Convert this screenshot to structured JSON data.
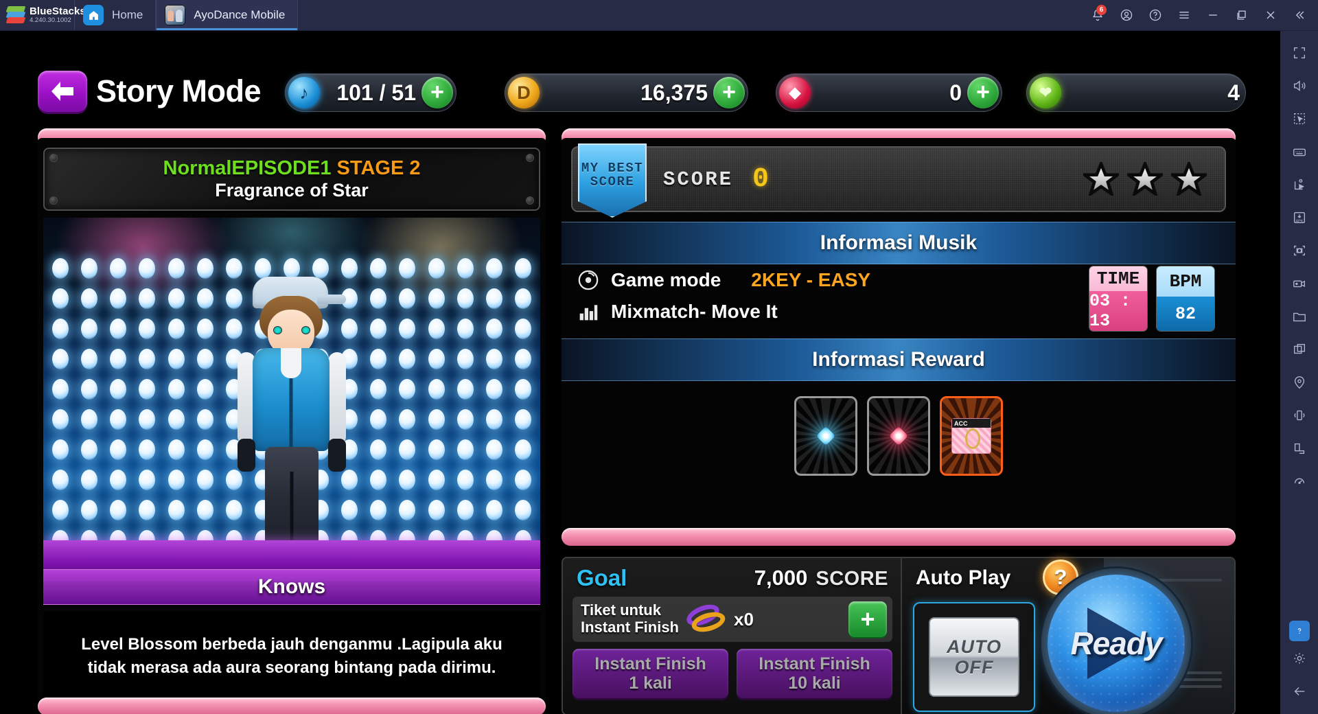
{
  "bluestacks": {
    "brand": "BlueStacks",
    "version": "4.240.30.1002",
    "tabs": [
      {
        "label": "Home",
        "icon": "home-icon",
        "active": false
      },
      {
        "label": "AyoDance Mobile",
        "icon": "game-thumbnail-icon",
        "active": true
      }
    ],
    "system_icons": [
      "bell-icon",
      "account-icon",
      "help-icon",
      "menu-icon",
      "minimize-icon",
      "maximize-icon",
      "close-icon",
      "collapse-icon"
    ],
    "notification_count": "6",
    "sidebar_icons": [
      "fullscreen-icon",
      "volume-icon",
      "multi-select-icon",
      "keyboard-controls-icon",
      "macro-icon",
      "install-apk-icon",
      "screenshot-icon",
      "screen-record-icon",
      "media-folder-icon",
      "multi-instance-icon",
      "location-icon",
      "shake-icon",
      "rotate-icon",
      "eco-mode-icon",
      "help-icon",
      "settings-icon",
      "back-icon"
    ]
  },
  "header": {
    "back_icon": "back-arrow-icon",
    "title": "Story Mode",
    "currencies": [
      {
        "id": "note",
        "icon": "note-icon",
        "value": "101 / 51",
        "has_plus": true,
        "plus_label": "+"
      },
      {
        "id": "gold",
        "icon": "gold-coin-icon",
        "value": "16,375",
        "has_plus": true,
        "plus_label": "+"
      },
      {
        "id": "gem",
        "icon": "diamond-icon",
        "value": "0",
        "has_plus": true,
        "plus_label": "+"
      },
      {
        "id": "heart",
        "icon": "heart-energy-icon",
        "value": "4",
        "has_plus": false,
        "plus_label": ""
      }
    ]
  },
  "left_panel": {
    "stage_info": {
      "difficulty": "NormalEPISODE1",
      "stage": "STAGE 2",
      "song_title": "Fragrance of Star"
    },
    "character_name": "Knows",
    "dialogue": "Level Blossom berbeda jauh denganmu .Lagipula aku tidak merasa ada aura seorang bintang pada dirimu."
  },
  "right_panel": {
    "best_score": {
      "ribbon_line1": "MY BEST",
      "ribbon_line2": "SCORE",
      "score_label": "SCORE",
      "score_value": "0",
      "stars_total": 3,
      "stars_earned": 0
    },
    "music_info": {
      "heading": "Informasi Musik",
      "game_mode_label": "Game mode",
      "game_mode_value": "2KEY - EASY",
      "song_label": "Mixmatch- Move It",
      "time_tag": "TIME",
      "time_value": "03 : 13",
      "bpm_tag": "BPM",
      "bpm_value": "82"
    },
    "reward_info": {
      "heading": "Informasi Reward",
      "cards": [
        {
          "id": "reward-1",
          "type": "blue-gem",
          "locked": true,
          "badge": ""
        },
        {
          "id": "reward-2",
          "type": "red-gem",
          "locked": true,
          "badge": ""
        },
        {
          "id": "reward-3",
          "type": "accessory-ring",
          "locked": false,
          "badge": "ACC"
        }
      ]
    }
  },
  "bottom": {
    "goal_label": "Goal",
    "goal_value": "7,000",
    "goal_unit": "SCORE",
    "ticket_label_line1": "Tiket untuk",
    "ticket_label_line2": "Instant Finish",
    "ticket_count": "x0",
    "ticket_plus_label": "+",
    "instant_finish_1": {
      "line1": "Instant Finish",
      "line2": "1 kali"
    },
    "instant_finish_10": {
      "line1": "Instant Finish",
      "line2": "10 kali"
    },
    "auto_play_label": "Auto Play",
    "auto_help_label": "?",
    "auto_toggle_line1": "AUTO",
    "auto_toggle_line2": "OFF",
    "ready_label": "Ready"
  },
  "colors": {
    "accent_pink": "#f48fae",
    "accent_purple": "#9b11c6",
    "accent_blue": "#2f93e8",
    "accent_orange": "#ffa51f",
    "accent_green": "#2faa3a",
    "goal_cyan": "#2fc0f4",
    "score_gold": "#f5c518",
    "difficulty_green": "#6ddf1e",
    "stage_orange": "#f79b16"
  }
}
